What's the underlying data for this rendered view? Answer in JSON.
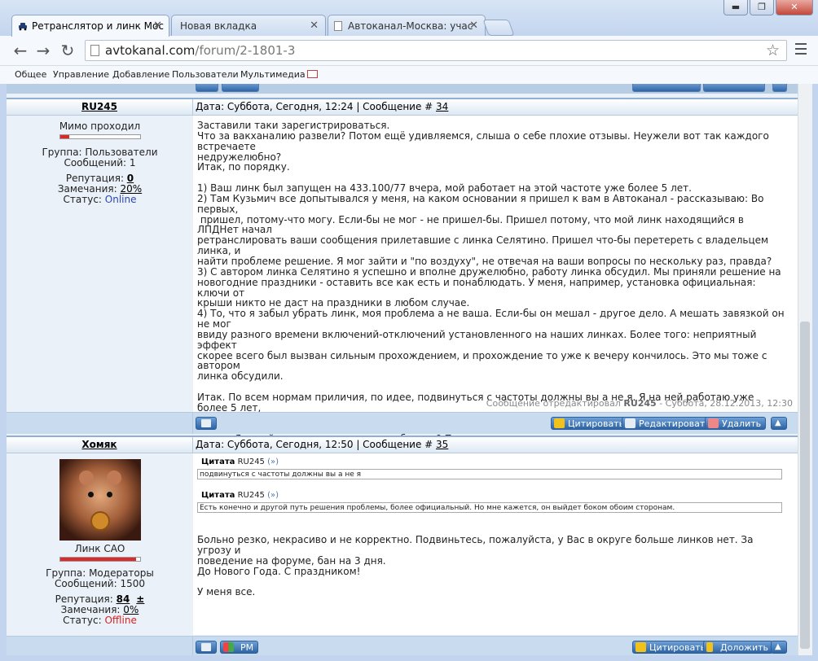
{
  "browser": {
    "tabs": [
      {
        "title": "Ретранслятор и линк Мос",
        "active": true
      },
      {
        "title": "Новая вкладка",
        "active": false
      },
      {
        "title": "Автоканал-Москва: учас",
        "active": false
      }
    ],
    "tab_close": "✕",
    "window_buttons": {
      "minimize": "▬",
      "maximize": "❐",
      "close": "✕"
    },
    "url_domain": "avtokanal.com",
    "url_path": "/forum/2-1801-3",
    "star": "☆",
    "back": "←",
    "forward": "→",
    "reload": "↻"
  },
  "bookmarks": [
    "Общее",
    "Управление",
    "Добавление",
    "Пользователи",
    "Мультимедиа"
  ],
  "posts": [
    {
      "author": "RU245",
      "meta_prefix": "Дата: Суббота, Сегодня, 12:24 | Сообщение # ",
      "number": "34",
      "rank": "Мимо проходил",
      "reputation_fill": 0.12,
      "group": "Группа: Пользователи",
      "messages": "Сообщений: 1",
      "reputation_label": "Репутация: ",
      "reputation_value": "0",
      "warnings_label": "Замечания: ",
      "warnings_value": "20%",
      "status_label": "Статус: ",
      "status_value": "Online",
      "text": "Заставили таки зарегистрироваться.\nЧто за вакханалию развели? Потом ещё удивляемся, слыша о себе плохие отзывы. Неужели вот так каждого встречаете\nнедружелюбно?\nИтак, по порядку.\n\n1) Ваш линк был запущен на 433.100/77 вчера, мой работает на этой частоте уже более 5 лет.\n2) Там Кузьмич все допытывался у меня, на каком основании я пришел к вам в Автоканал - рассказываю: Во первых,\n пришел, потому-что могу. Если-бы не мог - не пришел-бы. Пришел потому, что мой линк находящийся в ЛПДНет начал\nретранслировать ваши сообщения прилетавшие с линка Селятино. Пришел что-бы перетереть с владельцем линка, и\nнайти проблеме решение. Я мог зайти и \"по воздуху\", не отвечая на ваши вопросы по нескольку раз, правда?\n3) С автором линка Селятино я успешно и вполне дружелюбно, работу линка обсудил. Мы приняли решение на\nновогодние праздники - оставить все как есть и понаблюдать. У меня, например, установка официальная: ключи от\nкрыши никто не даст на праздники в любом случае.\n4) То, что я забыл убрать линк, моя проблема а не ваша. Если-бы он мешал - другое дело. А мешать завязкой он не мог\nввиду разного времени включений-отключений установленного на наших линках. Более того: неприятный эффект\nскорее всего был вызван сильным прохождением, и прохождение то уже к вечеру кончилось. Это мы тоже с автором\nлинка обсудили.\n\nИтак. По всем нормам приличия, по идее, подвинуться с частоты должны вы а не я. Я на ней работаю уже более 5 лет,\nа вы только запустились на ней. Тем не менее, я ни на кого не ругался, пришел и обсудил проблему, дал проблеме\nвремя. Я такой тиран что меня надо забанить? Приплыли.\nЕсть конечно и другой путь решения проблемы, более официальный. Но мне кажется, он выйдет боком обоим сторонам.\nС наступающим!",
      "edited_prefix": "Сообщение отредактировал ",
      "edited_user": "RU245",
      "edited_suffix": " - Суббота, 28.12.2013, 12:30",
      "buttons": {
        "quote": "Цитировать",
        "edit": "Редактировать",
        "delete": "Удалить"
      }
    },
    {
      "author": "Хомяк",
      "meta_prefix": "Дата: Суббота, Сегодня, 12:50 | Сообщение # ",
      "number": "35",
      "rank": "Линк САО",
      "reputation_fill": 0.95,
      "group": "Группа: Модераторы",
      "messages": "Сообщений: 1500",
      "reputation_label": "Репутация: ",
      "reputation_value": "84",
      "reputation_plusminus": "±",
      "warnings_label": "Замечания: ",
      "warnings_value": "0%",
      "status_label": "Статус: ",
      "status_value": "Offline",
      "quotes": [
        {
          "label": "Цитата",
          "user": "RU245",
          "arrow": "(»)",
          "text": "подвинуться с частоты должны вы а не я"
        },
        {
          "label": "Цитата",
          "user": "RU245",
          "arrow": "(»)",
          "text": "Есть конечно и другой путь решения проблемы, более официальный. Но мне кажется, он выйдет боком обоим сторонам."
        }
      ],
      "text": "Больно резко, некрасиво и не корректно. Подвиньтесь, пожалуйста, у Вас в округе больше линков нет. За угрозу и\nповедение на форуме, бан на 3 дня.\nДо Нового Года. С праздником!\n\nУ меня все.",
      "buttons": {
        "pm": "PM",
        "quote": "Цитировать",
        "report": "Доложить"
      }
    }
  ],
  "colors": {
    "accent": "#2e64a4",
    "online": "#2b47b5",
    "offline": "#d92020",
    "reputation_bar": "#d92b2b"
  }
}
